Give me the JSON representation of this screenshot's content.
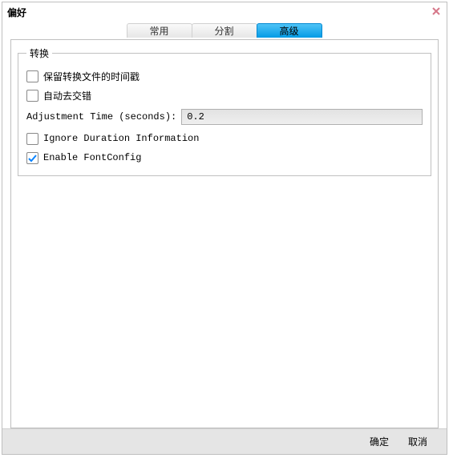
{
  "window": {
    "title": "偏好"
  },
  "tabs": {
    "common": "常用",
    "split": "分割",
    "advanced": "高级"
  },
  "group": {
    "legend": "转换",
    "preserve_timestamp": "保留转换文件的时间戳",
    "auto_deinterlace": "自动去交错",
    "adjustment_label": "Adjustment Time (seconds):",
    "adjustment_value": "0.2",
    "ignore_duration": "Ignore Duration Information",
    "enable_fontconfig": "Enable FontConfig"
  },
  "footer": {
    "ok": "确定",
    "cancel": "取消"
  }
}
